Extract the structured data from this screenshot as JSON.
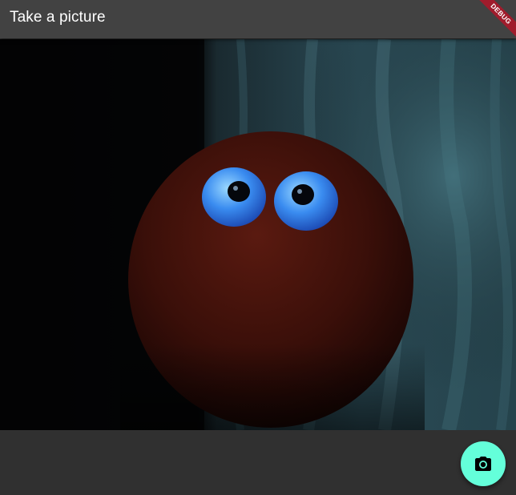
{
  "appbar": {
    "title": "Take a picture"
  },
  "debug_banner": {
    "label": "DEBUG"
  },
  "camera_preview": {
    "icon": "camera-preview"
  },
  "capture_button": {
    "icon": "camera-icon",
    "color": "#64ffda"
  },
  "colors": {
    "appbar": "#424242",
    "background": "#303030",
    "accent": "#64ffda",
    "debug": "#a01c2c"
  }
}
